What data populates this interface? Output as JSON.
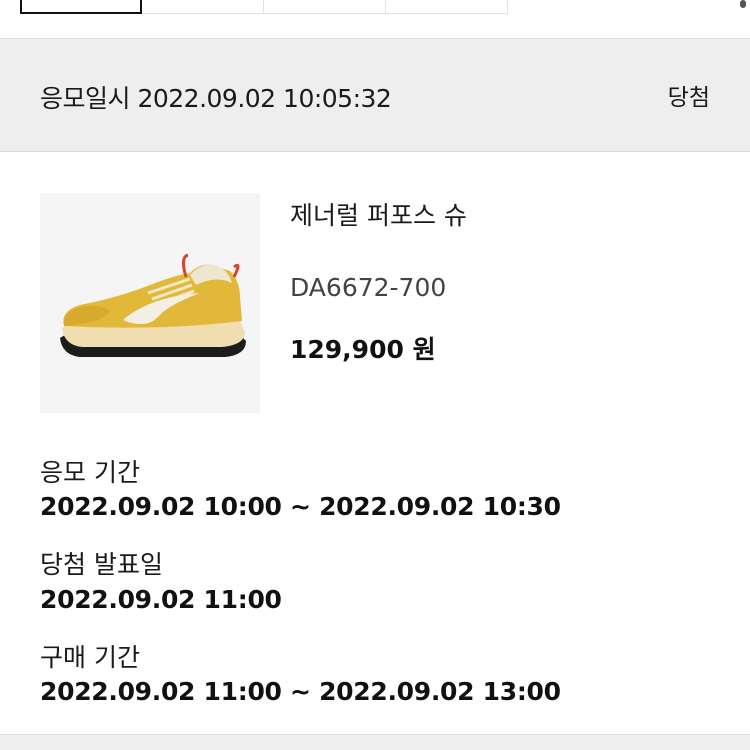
{
  "entry": {
    "time_label": "응모일시 2022.09.02 10:05:32",
    "status": "당첨"
  },
  "product": {
    "name": "제너럴 퍼포스 슈",
    "sku": "DA6672-700",
    "price": "129,900 원"
  },
  "info": [
    {
      "label": "응모 기간",
      "value": "2022.09.02 10:00 ~ 2022.09.02 10:30"
    },
    {
      "label": "당첨 발표일",
      "value": "2022.09.02 11:00"
    },
    {
      "label": "구매 기간",
      "value": "2022.09.02 11:00 ~ 2022.09.02 13:00"
    }
  ],
  "colors": {
    "header_bg": "#eeeeee",
    "shoe_main": "#e2b83a",
    "shoe_swoosh": "#f3efe2",
    "shoe_pulltab": "#d6452a",
    "shoe_sole": "#f0deb0",
    "shoe_outsole": "#1c1c1c"
  }
}
